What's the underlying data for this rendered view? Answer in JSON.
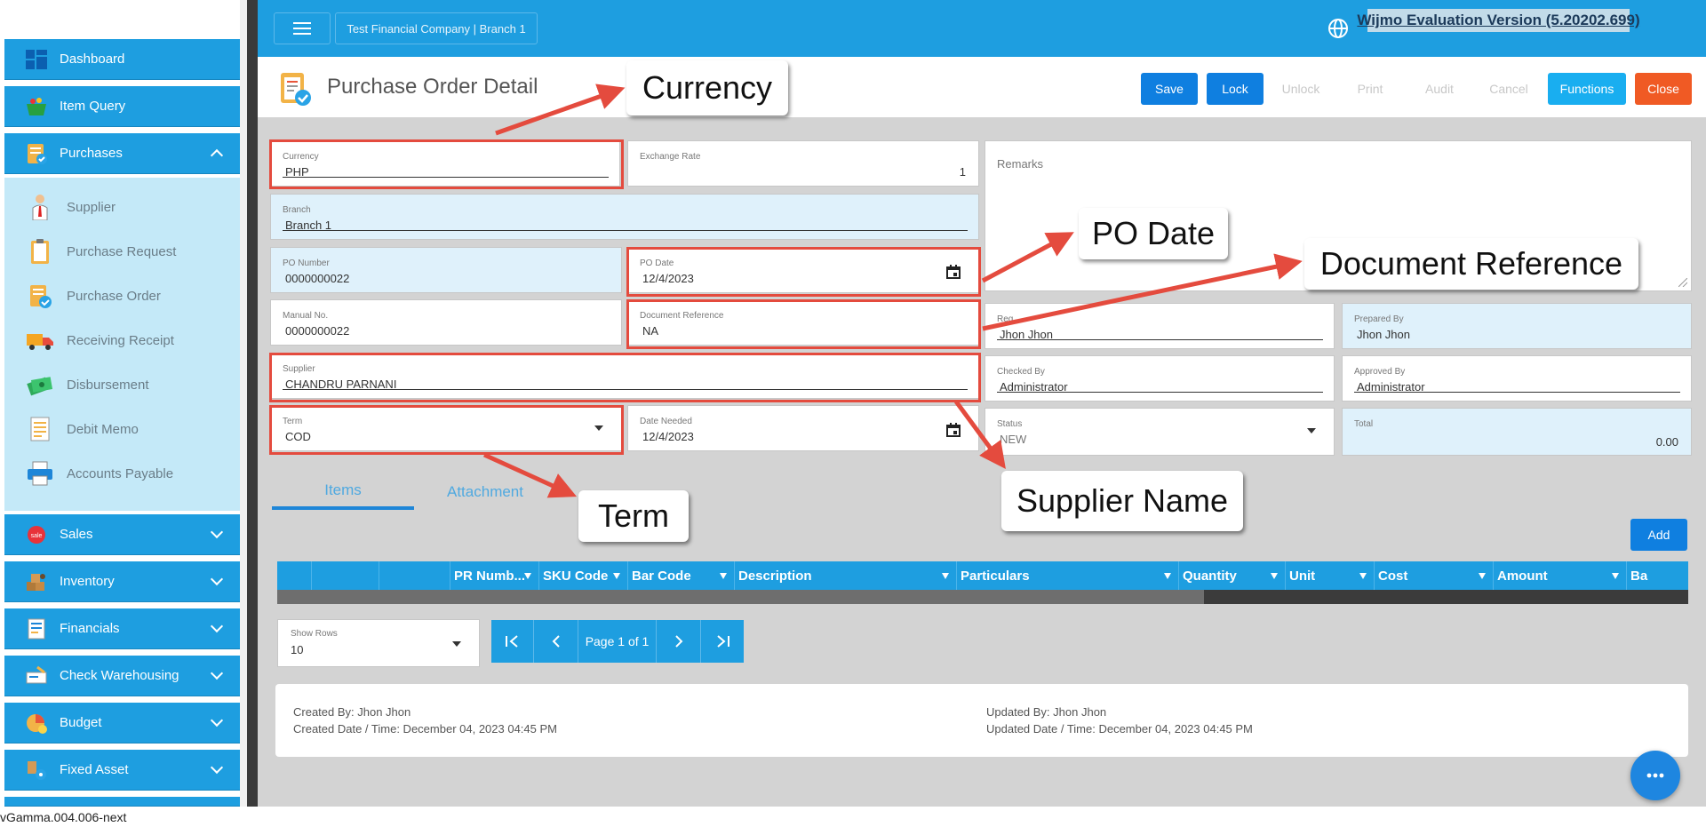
{
  "sidebar": {
    "items": [
      {
        "label": "Dashboard",
        "icon": "dashboard-icon"
      },
      {
        "label": "Item Query",
        "icon": "basket-icon"
      },
      {
        "label": "Purchases",
        "icon": "purchases-icon",
        "expanded": true
      },
      {
        "label": "Sales",
        "icon": "sale-tag-icon"
      },
      {
        "label": "Inventory",
        "icon": "inventory-icon"
      },
      {
        "label": "Financials",
        "icon": "financials-icon"
      },
      {
        "label": "Check Warehousing",
        "icon": "check-warehousing-icon"
      },
      {
        "label": "Budget",
        "icon": "budget-icon"
      },
      {
        "label": "Fixed Asset",
        "icon": "fixed-asset-icon"
      }
    ],
    "purchases_sub": [
      {
        "label": "Supplier",
        "icon": "supplier-person-icon"
      },
      {
        "label": "Purchase Request",
        "icon": "clipboard-icon"
      },
      {
        "label": "Purchase Order",
        "icon": "purchase-order-icon"
      },
      {
        "label": "Receiving Receipt",
        "icon": "truck-icon"
      },
      {
        "label": "Disbursement",
        "icon": "money-icon"
      },
      {
        "label": "Debit Memo",
        "icon": "memo-icon"
      },
      {
        "label": "Accounts Payable",
        "icon": "printer-icon"
      }
    ]
  },
  "topbar": {
    "company": "Test Financial Company | Branch 1",
    "watermark": "Wijmo Evaluation Version (5.20202.699)"
  },
  "page": {
    "title": "Purchase Order Detail",
    "buttons": {
      "save": "Save",
      "lock": "Lock",
      "unlock": "Unlock",
      "print": "Print",
      "audit": "Audit",
      "cancel": "Cancel",
      "functions": "Functions",
      "close": "Close"
    }
  },
  "form": {
    "currency": {
      "label": "Currency",
      "value": "PHP"
    },
    "exchange_rate": {
      "label": "Exchange Rate",
      "value": "1"
    },
    "branch": {
      "label": "Branch",
      "value": "Branch 1"
    },
    "po_number": {
      "label": "PO Number",
      "value": "0000000022"
    },
    "po_date": {
      "label": "PO Date",
      "value": "12/4/2023"
    },
    "manual_no": {
      "label": "Manual No.",
      "value": "0000000022"
    },
    "document_reference": {
      "label": "Document Reference",
      "value": "NA"
    },
    "supplier": {
      "label": "Supplier",
      "value": "CHANDRU PARNANI"
    },
    "term": {
      "label": "Term",
      "value": "COD"
    },
    "date_needed": {
      "label": "Date Needed",
      "value": "12/4/2023"
    },
    "remarks": {
      "label": "Remarks",
      "value": ""
    },
    "requested_by": {
      "label": "Req",
      "value": "Jhon Jhon"
    },
    "prepared_by": {
      "label": "Prepared By",
      "value": "Jhon Jhon"
    },
    "checked_by": {
      "label": "Checked By",
      "value": "Administrator"
    },
    "approved_by": {
      "label": "Approved By",
      "value": "Administrator"
    },
    "status": {
      "label": "Status",
      "value": "NEW"
    },
    "total": {
      "label": "Total",
      "value": "0.00"
    }
  },
  "callouts": {
    "currency": "Currency",
    "po_date": "PO Date",
    "document_reference": "Document Reference",
    "supplier_name": "Supplier Name",
    "term": "Term"
  },
  "tabs": {
    "items": "Items",
    "attachment": "Attachment"
  },
  "grid": {
    "add_label": "Add",
    "columns": [
      "PR Numb...",
      "SKU Code",
      "Bar Code",
      "Description",
      "Particulars",
      "Quantity",
      "Unit",
      "Cost",
      "Amount",
      "Ba"
    ]
  },
  "pager": {
    "show_rows_label": "Show Rows",
    "show_rows_value": "10",
    "page_text": "Page 1 of 1"
  },
  "footer": {
    "created_by": "Created By: Jhon Jhon",
    "created_date": "Created Date / Time: December 04, 2023 04:45 PM",
    "updated_by": "Updated By: Jhon Jhon",
    "updated_date": "Updated Date / Time: December 04, 2023 04:45 PM"
  },
  "version": "vGamma.004.006-next",
  "colors": {
    "primary": "#1e9ee0",
    "button_blue": "#0f7fe0",
    "close_red": "#f05a24",
    "highlight": "#e44b3e"
  }
}
